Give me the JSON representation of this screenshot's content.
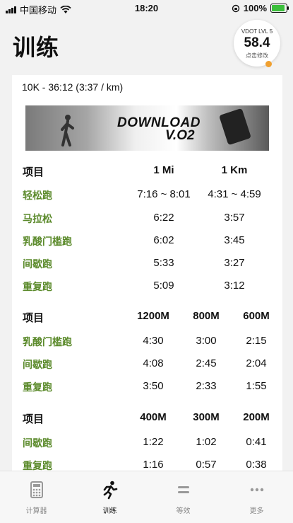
{
  "status_bar": {
    "carrier": "中国移动",
    "time": "18:20",
    "battery": "100%",
    "battery_level": 1.0
  },
  "header": {
    "title": "训练"
  },
  "vdot": {
    "level_label": "VDOT LVL 5",
    "value": "58.4",
    "hint": "点击修改"
  },
  "race": {
    "summary": "10K - 36:12 (3:37 / km)"
  },
  "banner": {
    "line1": "DOWNLOAD",
    "line2": "V.O2"
  },
  "table1": {
    "headers": [
      "项目",
      "1 Mi",
      "1 Km"
    ],
    "rows": [
      {
        "name": "轻松跑",
        "values": [
          "7:16 ~ 8:01",
          "4:31 ~ 4:59"
        ]
      },
      {
        "name": "马拉松",
        "values": [
          "6:22",
          "3:57"
        ]
      },
      {
        "name": "乳酸门槛跑",
        "values": [
          "6:02",
          "3:45"
        ]
      },
      {
        "name": "间歇跑",
        "values": [
          "5:33",
          "3:27"
        ]
      },
      {
        "name": "重复跑",
        "values": [
          "5:09",
          "3:12"
        ]
      }
    ]
  },
  "table2": {
    "headers": [
      "项目",
      "1200M",
      "800M",
      "600M"
    ],
    "rows": [
      {
        "name": "乳酸门槛跑",
        "values": [
          "4:30",
          "3:00",
          "2:15"
        ]
      },
      {
        "name": "间歇跑",
        "values": [
          "4:08",
          "2:45",
          "2:04"
        ]
      },
      {
        "name": "重复跑",
        "values": [
          "3:50",
          "2:33",
          "1:55"
        ]
      }
    ]
  },
  "table3": {
    "headers": [
      "项目",
      "400M",
      "300M",
      "200M"
    ],
    "rows": [
      {
        "name": "间歇跑",
        "values": [
          "1:22",
          "1:02",
          "0:41"
        ]
      },
      {
        "name": "重复跑",
        "values": [
          "1:16",
          "0:57",
          "0:38"
        ]
      }
    ]
  },
  "tabbar": {
    "items": [
      {
        "label": "计算器",
        "icon": "calculator-icon"
      },
      {
        "label": "训练",
        "icon": "runner-icon",
        "active": true
      },
      {
        "label": "等效",
        "icon": "equals-icon"
      },
      {
        "label": "更多",
        "icon": "more-icon"
      }
    ]
  }
}
